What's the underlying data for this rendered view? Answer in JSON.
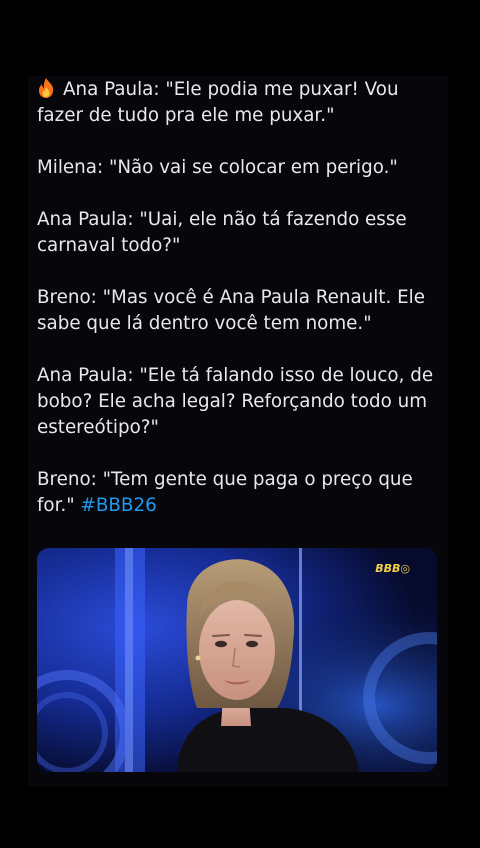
{
  "post": {
    "lines": [
      "Ana Paula: \"Ele podia me puxar! Vou fazer de tudo pra ele me puxar.\"",
      "Milena: \"Não vai se colocar em perigo.\"",
      "Ana Paula: \"Uai, ele não tá fazendo esse carnaval todo?\"",
      "Breno: \"Mas você é Ana Paula Renault. Ele sabe que lá dentro você tem nome.\"",
      "Ana Paula: \"Ele tá falando isso de louco, de bobo? Ele acha legal? Reforçando todo um estereótipo?\"",
      "Breno: \"Tem gente que paga o preço que for.\""
    ],
    "hashtag": "#BBB26",
    "lead_icon": "fire-emoji-icon"
  },
  "media": {
    "logo_text": "BBB",
    "colors": {
      "background": "#0a1346",
      "glow": "#2b4bd8"
    }
  },
  "colors": {
    "text": "#e7e9ea",
    "hashtag": "#1d9bf0",
    "card": "#07060a"
  }
}
